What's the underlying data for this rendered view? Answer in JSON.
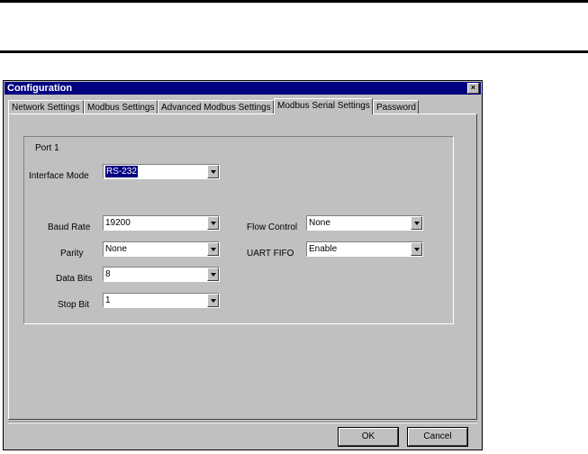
{
  "window": {
    "title": "Configuration",
    "close_glyph": "×"
  },
  "tabs": [
    {
      "label": "Network Settings"
    },
    {
      "label": "Modbus Settings"
    },
    {
      "label": "Advanced Modbus Settings"
    },
    {
      "label": "Modbus Serial Settings"
    },
    {
      "label": "Password"
    }
  ],
  "active_tab": "Modbus Serial Settings",
  "port": {
    "title": "Port 1",
    "interface_mode": {
      "label": "Interface Mode",
      "value": "RS-232"
    },
    "baud_rate": {
      "label": "Baud Rate",
      "value": "19200"
    },
    "parity": {
      "label": "Parity",
      "value": "None"
    },
    "data_bits": {
      "label": "Data Bits",
      "value": "8"
    },
    "stop_bit": {
      "label": "Stop Bit",
      "value": "1"
    },
    "flow_control": {
      "label": "Flow Control",
      "value": "None"
    },
    "uart_fifo": {
      "label": "UART FIFO",
      "value": "Enable"
    }
  },
  "buttons": {
    "ok": "OK",
    "cancel": "Cancel"
  },
  "colors": {
    "titlebar": "#000080",
    "face": "#c0c0c0",
    "selection": "#000080"
  }
}
